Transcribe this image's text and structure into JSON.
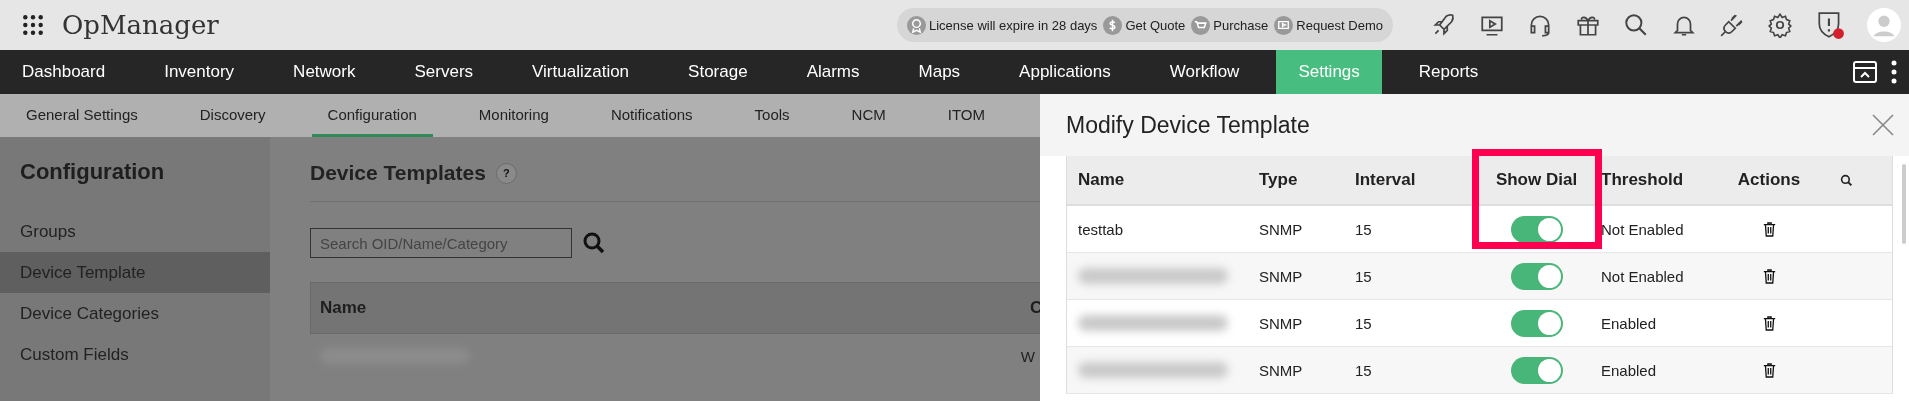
{
  "app": {
    "title": "OpManager"
  },
  "promo": [
    {
      "kind": "license",
      "label": "License will expire in 28 days"
    },
    {
      "kind": "quote",
      "label": "Get Quote"
    },
    {
      "kind": "cart",
      "label": "Purchase"
    },
    {
      "kind": "demo",
      "label": "Request Demo"
    }
  ],
  "toolbar_icons": [
    {
      "kind": "rocket"
    },
    {
      "kind": "video"
    },
    {
      "kind": "headset"
    },
    {
      "kind": "gift"
    },
    {
      "kind": "search"
    },
    {
      "kind": "bell"
    },
    {
      "kind": "plug"
    },
    {
      "kind": "gear"
    },
    {
      "kind": "alert",
      "badge": true
    },
    {
      "kind": "avatar"
    }
  ],
  "nav": [
    {
      "label": "Dashboard",
      "selected": false
    },
    {
      "label": "Inventory",
      "selected": false
    },
    {
      "label": "Network",
      "selected": false
    },
    {
      "label": "Servers",
      "selected": false
    },
    {
      "label": "Virtualization",
      "selected": false
    },
    {
      "label": "Storage",
      "selected": false
    },
    {
      "label": "Alarms",
      "selected": false
    },
    {
      "label": "Maps",
      "selected": false
    },
    {
      "label": "Applications",
      "selected": false
    },
    {
      "label": "Workflow",
      "selected": false
    },
    {
      "label": "Settings",
      "selected": true
    },
    {
      "label": "Reports",
      "selected": false
    }
  ],
  "subnav": [
    {
      "label": "General Settings",
      "selected": false
    },
    {
      "label": "Discovery",
      "selected": false
    },
    {
      "label": "Configuration",
      "selected": true
    },
    {
      "label": "Monitoring",
      "selected": false
    },
    {
      "label": "Notifications",
      "selected": false
    },
    {
      "label": "Tools",
      "selected": false
    },
    {
      "label": "NCM",
      "selected": false
    },
    {
      "label": "ITOM",
      "selected": false
    }
  ],
  "sidebar": {
    "title": "Configuration",
    "items": [
      {
        "label": "Groups",
        "selected": false
      },
      {
        "label": "Device Template",
        "selected": true
      },
      {
        "label": "Device Categories",
        "selected": false
      },
      {
        "label": "Custom Fields",
        "selected": false
      }
    ]
  },
  "page": {
    "title": "Device Templates",
    "help": "?",
    "search": {
      "placeholder": "Search OID/Name/Category"
    },
    "table": {
      "columns": [
        "Name",
        "C"
      ],
      "rows": [
        {
          "name_blurred": true,
          "column_2": "W"
        }
      ]
    }
  },
  "modal": {
    "title": "Modify Device Template",
    "columns": [
      "Name",
      "Type",
      "Interval",
      "Show Dial",
      "Threshold",
      "Actions"
    ],
    "rows": [
      {
        "name": "testtab",
        "name_blurred": false,
        "type": "SNMP",
        "interval": "15",
        "show_dial": true,
        "threshold": "Not Enabled"
      },
      {
        "name_blurred": true,
        "type": "SNMP",
        "interval": "15",
        "show_dial": true,
        "threshold": "Not Enabled"
      },
      {
        "name_blurred": true,
        "type": "SNMP",
        "interval": "15",
        "show_dial": true,
        "threshold": "Enabled"
      },
      {
        "name_blurred": true,
        "type": "SNMP",
        "interval": "15",
        "show_dial": true,
        "threshold": "Enabled"
      }
    ]
  }
}
